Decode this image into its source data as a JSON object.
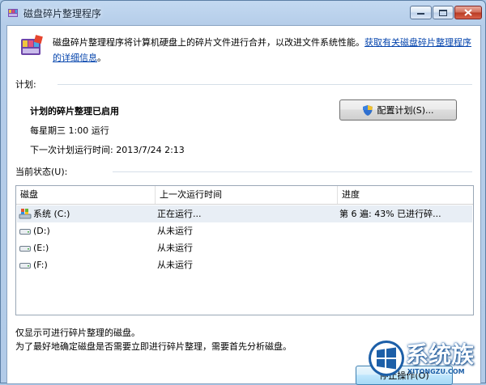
{
  "window": {
    "title": "磁盘碎片整理程序"
  },
  "intro": {
    "text": "磁盘碎片整理程序将计算机硬盘上的碎片文件进行合并，以改进文件系统性能。",
    "link_text": "获取有关磁盘碎片整理程序的详细信息",
    "end": "。"
  },
  "schedule": {
    "section_label": "计划:",
    "status_title": "计划的碎片整理已启用",
    "frequency": "每星期三  1:00 运行",
    "next_run": "下一次计划运行时间: 2013/7/24 2:13",
    "config_button": "配置计划(S)..."
  },
  "current_status": {
    "section_label": "当前状态(U):",
    "columns": [
      "磁盘",
      "上一次运行时间",
      "进度"
    ],
    "rows": [
      {
        "disk": "系统 (C:)",
        "last_run": "正在运行...",
        "progress": "第 6 遍: 43% 已进行碎...",
        "icon": "system-drive-icon"
      },
      {
        "disk": "(D:)",
        "last_run": "从未运行",
        "progress": "",
        "icon": "drive-icon"
      },
      {
        "disk": "(E:)",
        "last_run": "从未运行",
        "progress": "",
        "icon": "drive-icon"
      },
      {
        "disk": "(F:)",
        "last_run": "从未运行",
        "progress": "",
        "icon": "drive-icon"
      }
    ]
  },
  "notes": {
    "line1": "仅显示可进行碎片整理的磁盘。",
    "line2": "为了最好地确定磁盘是否需要立即进行碎片整理，需要首先分析磁盘。"
  },
  "footer": {
    "stop_button": "停止操作(O)"
  },
  "watermark": {
    "text": "系统族",
    "url": "XITONGZU.COM"
  },
  "colors": {
    "link": "#0645ad",
    "titlebar": "#b5cde9",
    "close_button": "#c94a33",
    "watermark_blue": "#1c5fa8"
  }
}
